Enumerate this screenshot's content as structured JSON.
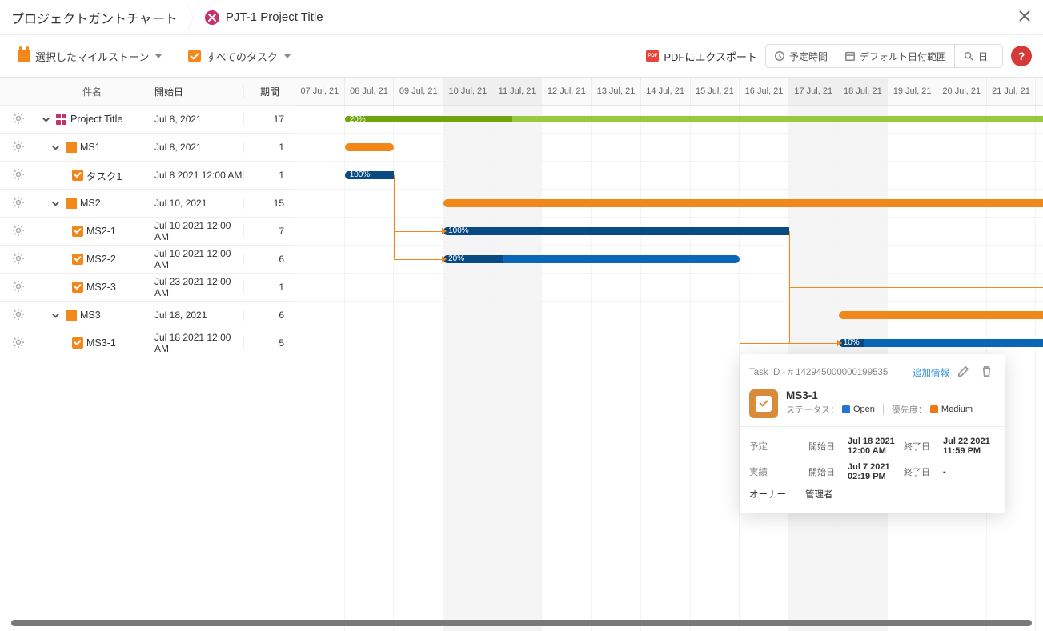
{
  "breadcrumb": {
    "root": "プロジェクトガントチャート",
    "project_id": "PJT-1 Project Title"
  },
  "toolbar": {
    "milestones": "選択したマイルストーン",
    "tasks": "すべてのタスク",
    "export": "PDFにエクスポート",
    "planned_time": "予定時間",
    "date_range": "デフォルト日付範囲",
    "zoom": "日",
    "help": "?"
  },
  "columns": {
    "name": "件名",
    "start": "開始日",
    "duration": "期間"
  },
  "dates": [
    "07 Jul, 21",
    "08 Jul, 21",
    "09 Jul, 21",
    "10 Jul, 21",
    "11 Jul, 21",
    "12 Jul, 21",
    "13 Jul, 21",
    "14 Jul, 21",
    "15 Jul, 21",
    "16 Jul, 21",
    "17 Jul, 21",
    "18 Jul, 21",
    "19 Jul, 21",
    "20 Jul, 21",
    "21 Jul, 21"
  ],
  "rows": [
    {
      "name": "Project Title",
      "start": "Jul 8, 2021",
      "dur": "17",
      "type": "project",
      "indent": 0,
      "pct": "20%"
    },
    {
      "name": "MS1",
      "start": "Jul 8, 2021",
      "dur": "1",
      "type": "ms",
      "indent": 1
    },
    {
      "name": "タスク1",
      "start": "Jul 8 2021 12:00 AM",
      "dur": "1",
      "type": "task",
      "indent": 2,
      "pct": "100%"
    },
    {
      "name": "MS2",
      "start": "Jul 10, 2021",
      "dur": "15",
      "type": "ms",
      "indent": 1
    },
    {
      "name": "MS2-1",
      "start": "Jul 10 2021 12:00 AM",
      "dur": "7",
      "type": "task",
      "indent": 2,
      "pct": "100%"
    },
    {
      "name": "MS2-2",
      "start": "Jul 10 2021 12:00 AM",
      "dur": "6",
      "type": "task",
      "indent": 2,
      "pct": "20%"
    },
    {
      "name": "MS2-3",
      "start": "Jul 23 2021 12:00 AM",
      "dur": "1",
      "type": "task",
      "indent": 2
    },
    {
      "name": "MS3",
      "start": "Jul 18, 2021",
      "dur": "6",
      "type": "ms",
      "indent": 1
    },
    {
      "name": "MS3-1",
      "start": "Jul 18 2021 12:00 AM",
      "dur": "5",
      "type": "task",
      "indent": 2,
      "pct": "10%"
    }
  ],
  "tooltip": {
    "id_prefix": "Task ID - # ",
    "id": "142945000000199535",
    "more": "追加情報",
    "title": "MS3-1",
    "status_label": "ステータス：",
    "status": "Open",
    "priority_label": "優先度：",
    "priority": "Medium",
    "planned": "予定",
    "actual": "実績",
    "start_label": "開始日",
    "end_label": "終了日",
    "planned_start": "Jul 18 2021 12:00 AM",
    "planned_end": "Jul 22 2021 11:59 PM",
    "actual_start": "Jul 7 2021 02:19 PM",
    "actual_end": "-",
    "owner_label": "オーナー",
    "owner": "管理者"
  }
}
